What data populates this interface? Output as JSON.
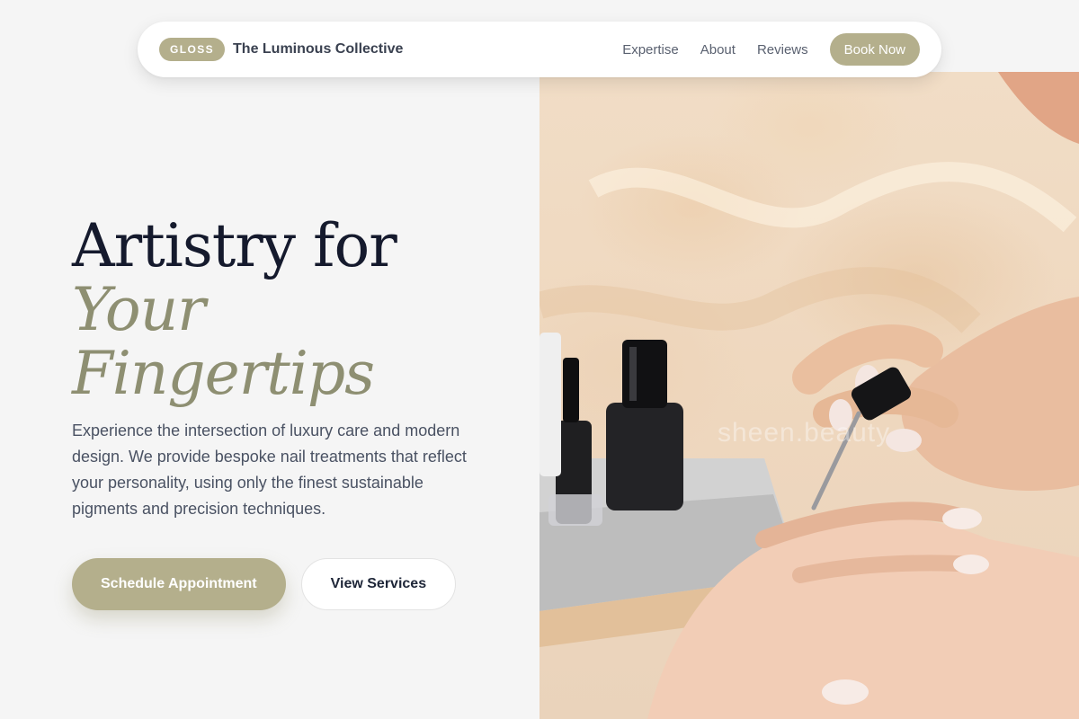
{
  "nav": {
    "badge": "GLOSS",
    "brand_name": "The Luminous Collective",
    "links": [
      {
        "label": "Expertise"
      },
      {
        "label": "About"
      },
      {
        "label": "Reviews"
      }
    ],
    "cta": "Book Now"
  },
  "hero": {
    "title_line1": "Artistry for",
    "title_accent_line1": "Your",
    "title_accent_line2": "Fingertips",
    "description": "Experience the intersection of luxury care and modern design. We provide bespoke nail treatments that reflect your personality, using only the finest sustainable pigments and precision techniques.",
    "primary_button": "Schedule Appointment",
    "secondary_button": "View Services",
    "image_watermark": "sheen.beauty"
  },
  "colors": {
    "accent": "#b4af8c",
    "title_dark": "#151a2d",
    "title_accent": "#8e8f72",
    "background": "#f5f5f5"
  }
}
